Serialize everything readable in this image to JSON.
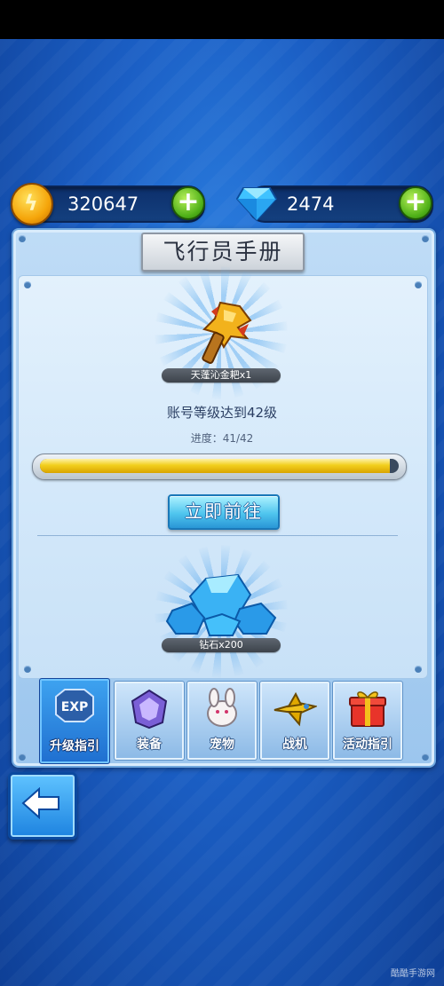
{
  "currency": {
    "coins": "320647",
    "gems": "2474",
    "add_label": "+"
  },
  "panel": {
    "title": "飞行员手册"
  },
  "quest": {
    "reward_top": "天蓬沁金耙x1",
    "description": "账号等级达到42级",
    "progress_text": "进度：41/42",
    "progress_current": 41,
    "progress_total": 42,
    "go_button": "立即前往",
    "reward_bottom": "钻石x200"
  },
  "tabs": [
    {
      "label": "升级指引",
      "icon": "exp-icon",
      "active": true
    },
    {
      "label": "装备",
      "icon": "equipment-icon",
      "active": false
    },
    {
      "label": "宠物",
      "icon": "pet-icon",
      "active": false
    },
    {
      "label": "战机",
      "icon": "fighter-jet-icon",
      "active": false
    },
    {
      "label": "活动指引",
      "icon": "gift-box-icon",
      "active": false
    }
  ],
  "exp_badge": "EXP",
  "back_button_icon": "back-arrow-icon",
  "watermark": "酷酷手游网",
  "colors": {
    "accent_blue": "#1f6fd0",
    "progress_yellow": "#f2cf1d",
    "plus_green": "#4fb018"
  }
}
